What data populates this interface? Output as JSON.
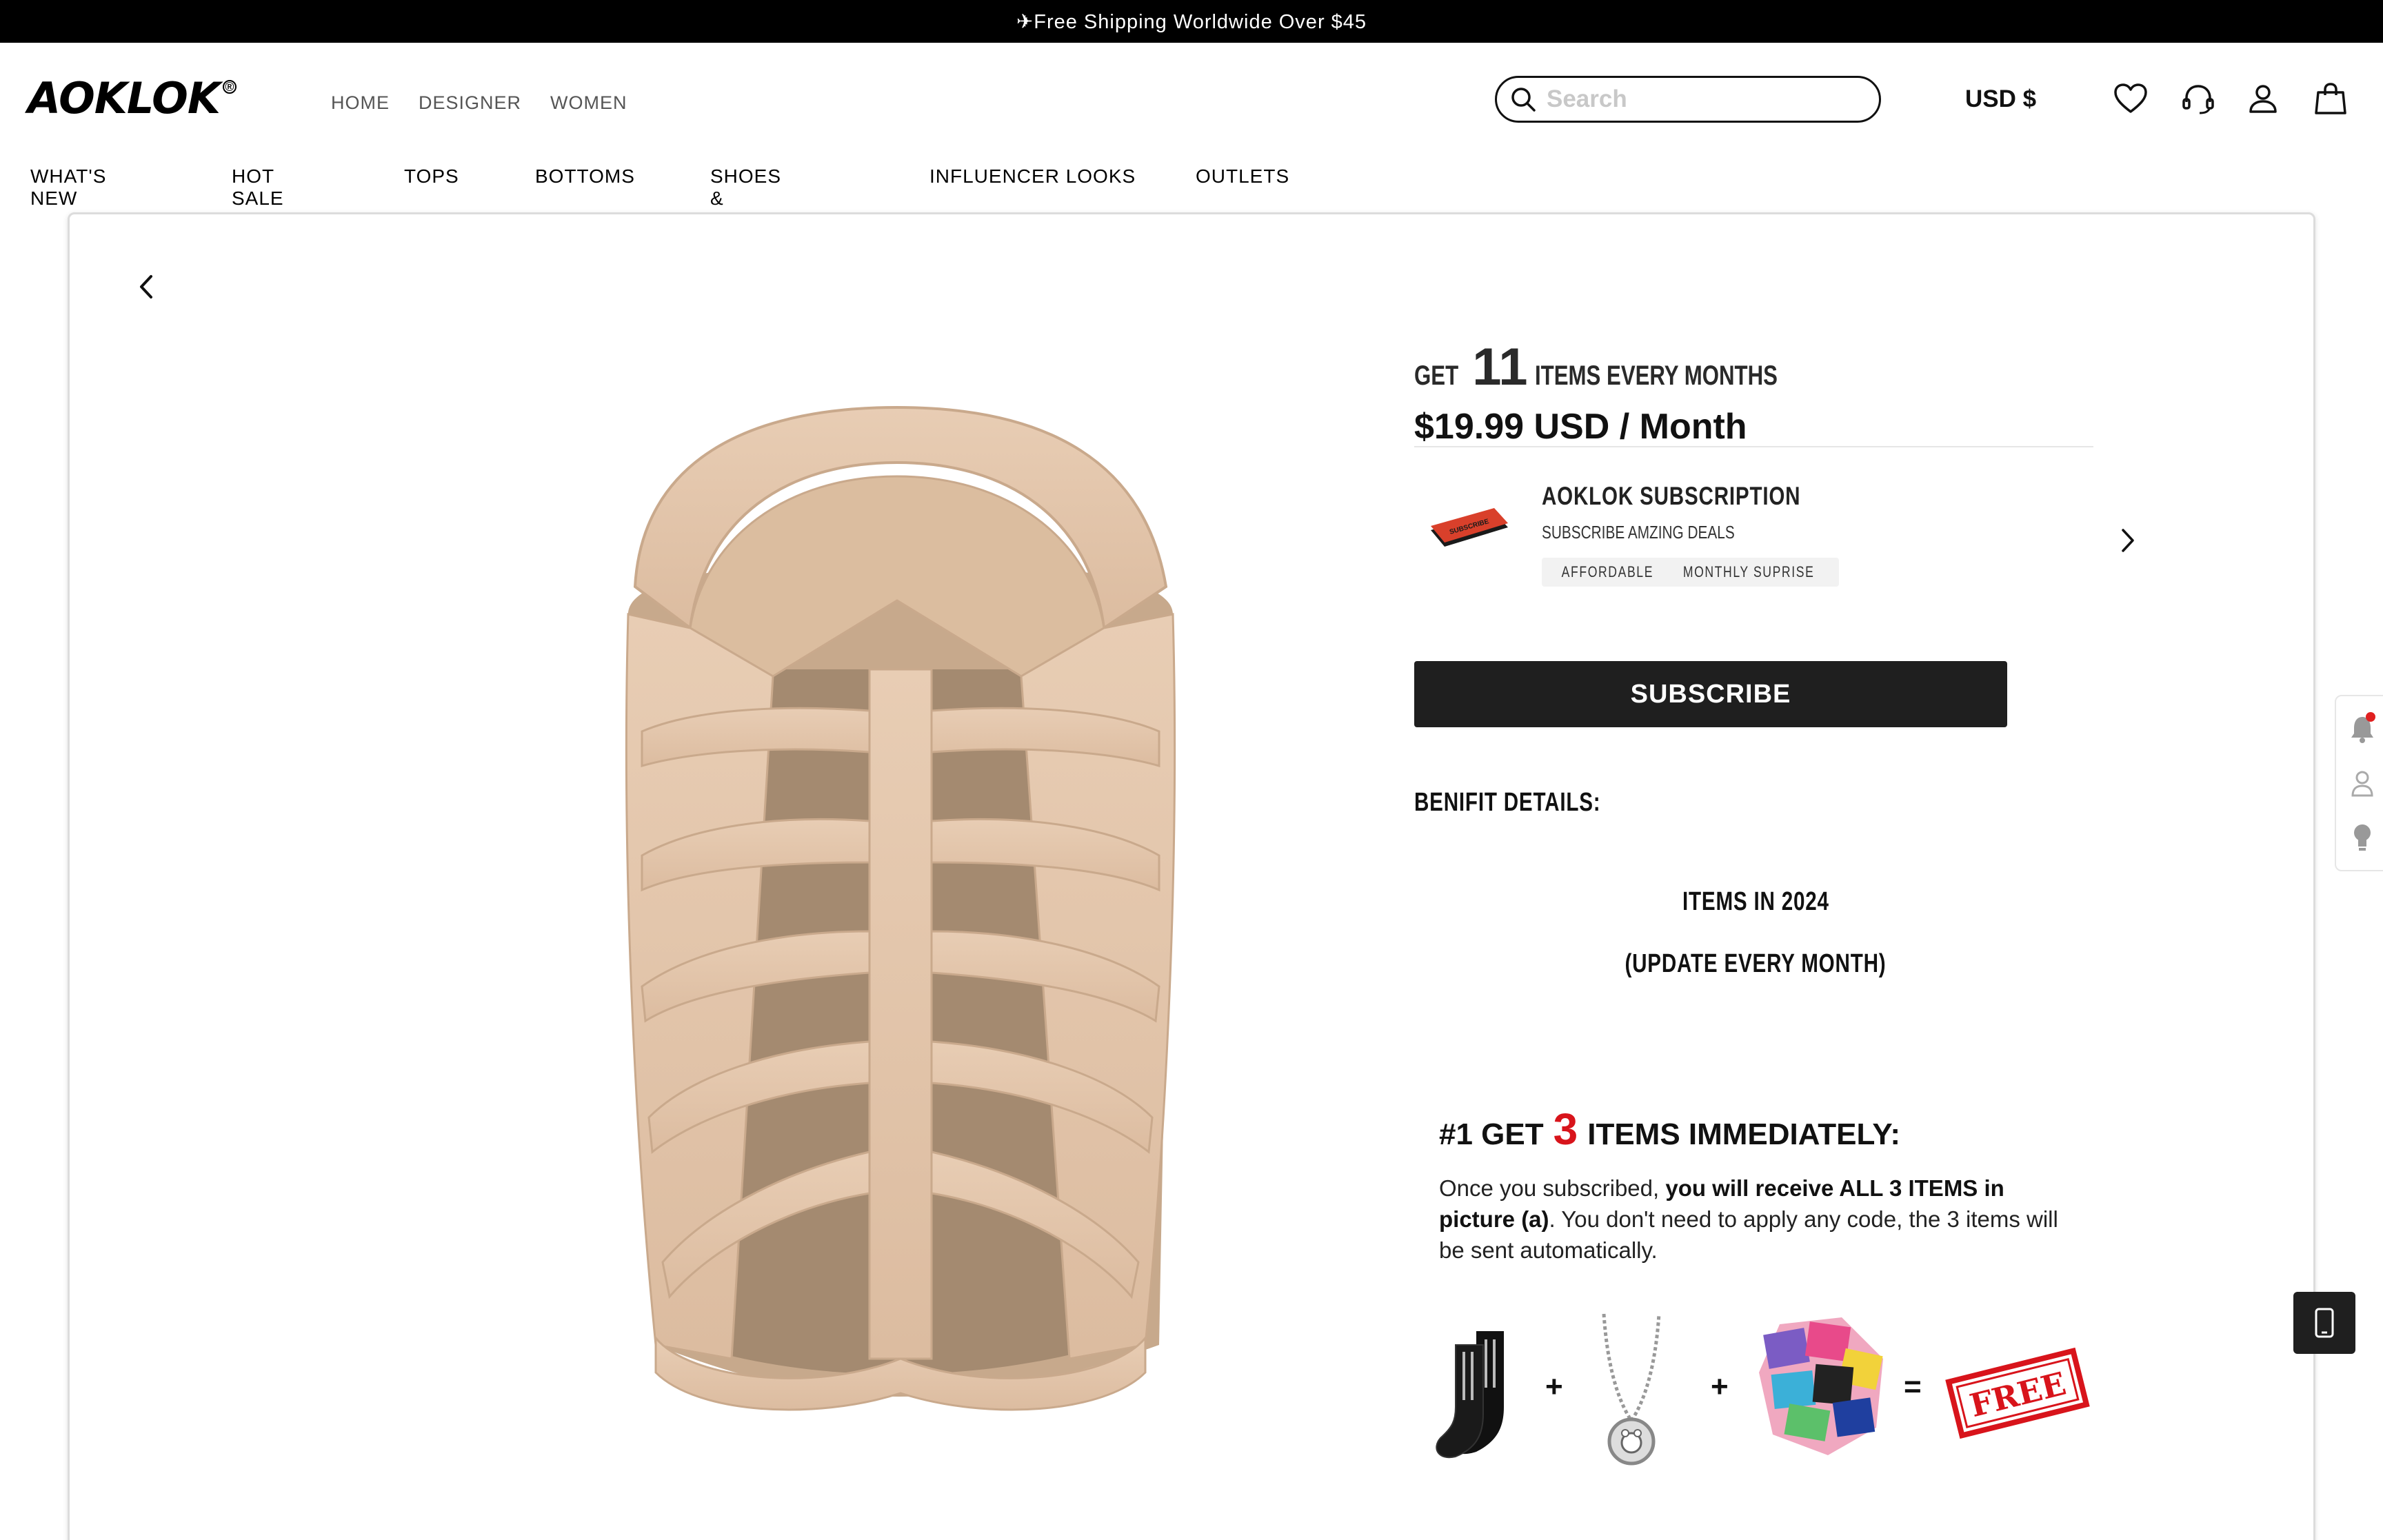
{
  "announcement": "✈Free Shipping Worldwide Over $45",
  "header": {
    "logo": "AOKLOK",
    "logo_mark": "®",
    "nav": [
      "HOME",
      "DESIGNER",
      "WOMEN"
    ],
    "search_placeholder": "Search",
    "currency": "USD $",
    "icons": [
      "heart-icon",
      "headset-icon",
      "user-icon",
      "bag-icon"
    ]
  },
  "categories": [
    "WHAT'S NEW",
    "HOT SALE",
    "TOPS",
    "BOTTOMS",
    "SHOES & ACCS",
    "INFLUENCER LOOKS",
    "OUTLETS"
  ],
  "offer": {
    "get_prefix": "GET",
    "get_count": "11",
    "get_suffix": "ITEMS EVERY MONTHS",
    "price": "$19.99 USD / Month",
    "card": {
      "ticket_text": "SUBSCRIBE",
      "title": "AOKLOK SUBSCRIPTION",
      "description": "SUBSCRIBE AMZING DEALS",
      "tags": [
        "AFFORDABLE",
        "MONTHLY SUPRISE"
      ]
    },
    "subscribe_button": "SUBSCRIBE",
    "benefit_heading": "BENIFIT DETAILS:",
    "items_year": "ITEMS IN 2024",
    "update_note": "(UPDATE EVERY MONTH)",
    "step1": {
      "prefix": "#1  GET",
      "count": "3",
      "suffix": "ITEMS IMMEDIATELY:",
      "text_plain_1": "Once you subscribed, ",
      "text_bold": "you will receive ALL 3 ITEMS in picture (a)",
      "text_plain_2": ". You don't need to apply any code, the 3 items will be sent automatically.",
      "stamp": "FREE",
      "operators": [
        "+",
        "+",
        "="
      ]
    }
  },
  "colors": {
    "accent_red": "#d8141b",
    "button_dark": "#1f1f1f",
    "product_beige": "#e4c8ad"
  }
}
